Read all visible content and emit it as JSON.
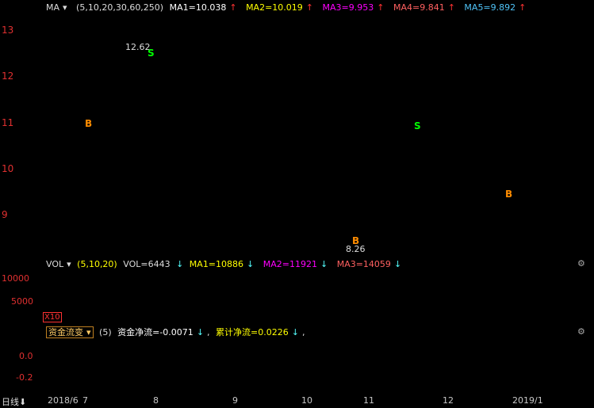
{
  "price_panel": {
    "indicator": "MA",
    "dropdown_icon": "triangle-down-icon",
    "params": "(5,10,20,30,60,250)",
    "ma1": "MA1=10.038",
    "ma2": "MA2=10.019",
    "ma3": "MA3=9.953",
    "ma4": "MA4=9.841",
    "ma5": "MA5=9.892",
    "arrow_up": "↑",
    "y_ticks": [
      "13",
      "12",
      "11",
      "10",
      "9"
    ],
    "high_label": "12.62",
    "low_label": "8.26",
    "sell_marks": [
      "S",
      "S"
    ],
    "buy_marks": [
      "B",
      "B",
      "B"
    ],
    "colors": {
      "up": "#ff3232",
      "down": "#54fcfc",
      "ma1": "#ffffff",
      "ma2": "#ffff00",
      "ma3": "#ff00ff",
      "ma4": "#00ff00",
      "ma5": "#4fc3f7",
      "ma6": "#ff8080"
    }
  },
  "volume_panel": {
    "indicator": "VOL",
    "params": "(5,10,20)",
    "vol": "VOL=6443",
    "ma1": "MA1=10886",
    "ma2": "MA2=11921",
    "ma3": "MA3=14059",
    "arrow_down": "↓",
    "y_ticks": [
      "10000",
      "5000"
    ],
    "scale": "X10"
  },
  "fund_panel": {
    "indicator": "资金流变",
    "params": "(5)",
    "net_flow": "资金净流=-0.0071",
    "cum_flow": "累计净流=0.0226",
    "sep": ",",
    "y_ticks": [
      "0.0",
      "-0.2"
    ]
  },
  "xaxis": {
    "period": "日线",
    "period_icon": "arrow-down-icon",
    "labels": [
      "2018/6",
      "7",
      "8",
      "9",
      "10",
      "11",
      "12",
      "2019/1"
    ]
  }
}
